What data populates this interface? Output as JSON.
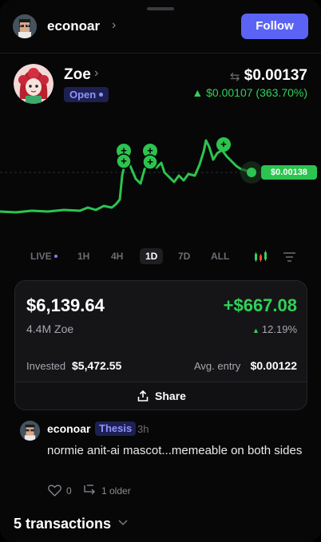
{
  "header": {
    "username": "econoar",
    "follow_label": "Follow"
  },
  "token": {
    "name": "Zoe",
    "status": "Open",
    "price": "$0.00137",
    "change": "▲ $0.00107 (363.70%)",
    "current_price_tag": "$0.00138"
  },
  "timeframes": [
    "LIVE",
    "1H",
    "4H",
    "1D",
    "7D",
    "ALL"
  ],
  "selected_timeframe": "1D",
  "position": {
    "value": "$6,139.64",
    "pnl": "+$667.08",
    "holdings": "4.4M Zoe",
    "pnl_pct": "12.19%",
    "invested_label": "Invested",
    "invested_value": "$5,472.55",
    "avg_entry_label": "Avg. entry",
    "avg_entry_value": "$0.00122",
    "share_label": "Share"
  },
  "comment": {
    "user": "econoar",
    "badge": "Thesis",
    "time": "3h",
    "text": "normie anit-ai mascot...memeable on both sides",
    "likes": "0",
    "replies_label": "1 older"
  },
  "transactions_label": "5 transactions",
  "colors": {
    "accent": "#5b63f5",
    "positive": "#30d158",
    "badge_bg": "#1e2052"
  },
  "icons": [
    "chevron-right-icon",
    "swap-icon",
    "candlestick-icon",
    "filter-icon",
    "share-icon",
    "heart-icon",
    "reply-icon",
    "chevron-down-icon"
  ]
}
